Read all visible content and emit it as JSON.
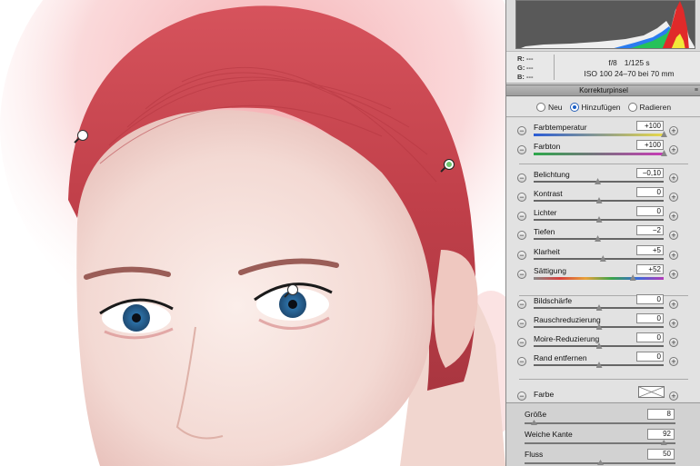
{
  "photo": {
    "pins": [
      {
        "name": "pin-left-hairline",
        "active": false
      },
      {
        "name": "pin-right-hair",
        "active": true
      },
      {
        "name": "pin-eye",
        "active": false
      }
    ]
  },
  "info": {
    "r_label": "R:",
    "r_value": "---",
    "g_label": "G:",
    "g_value": "---",
    "b_label": "B:",
    "b_value": "---",
    "aperture": "f/8",
    "shutter": "1/125 s",
    "iso": "ISO 100",
    "lens": "24–70 bei 70 mm"
  },
  "panel": {
    "title": "Korrekturpinsel",
    "modes": [
      {
        "label": "Neu",
        "selected": false
      },
      {
        "label": "Hinzufügen",
        "selected": true
      },
      {
        "label": "Radieren",
        "selected": false
      }
    ]
  },
  "sliders": [
    {
      "key": "farbtemperatur",
      "label": "Farbtemperatur",
      "value": "+100",
      "fraction": 1.0,
      "track": "temp"
    },
    {
      "key": "farbton",
      "label": "Farbton",
      "value": "+100",
      "fraction": 1.0,
      "track": "tint"
    },
    {
      "key": "belichtung",
      "label": "Belichtung",
      "value": "−0,10",
      "fraction": 0.49,
      "track": "plain"
    },
    {
      "key": "kontrast",
      "label": "Kontrast",
      "value": "0",
      "fraction": 0.5,
      "track": "plain"
    },
    {
      "key": "lichter",
      "label": "Lichter",
      "value": "0",
      "fraction": 0.5,
      "track": "plain"
    },
    {
      "key": "tiefen",
      "label": "Tiefen",
      "value": "−2",
      "fraction": 0.49,
      "track": "plain"
    },
    {
      "key": "klarheit",
      "label": "Klarheit",
      "value": "+5",
      "fraction": 0.53,
      "track": "plain"
    },
    {
      "key": "saettigung",
      "label": "Sättigung",
      "value": "+52",
      "fraction": 0.76,
      "track": "sat"
    },
    {
      "key": "bildschaerfe",
      "label": "Bildschärfe",
      "value": "0",
      "fraction": 0.5,
      "track": "plain"
    },
    {
      "key": "rauschreduzierung",
      "label": "Rauschreduzierung",
      "value": "0",
      "fraction": 0.5,
      "track": "plain"
    },
    {
      "key": "moire",
      "label": "Moire-Reduzierung",
      "value": "0",
      "fraction": 0.5,
      "track": "plain"
    },
    {
      "key": "rand",
      "label": "Rand entfernen",
      "value": "0",
      "fraction": 0.5,
      "track": "plain"
    }
  ],
  "farbe": {
    "label": "Farbe"
  },
  "brush": [
    {
      "key": "groesse",
      "label": "Größe",
      "value": "8",
      "fraction": 0.06
    },
    {
      "key": "weiche_kante",
      "label": "Weiche Kante",
      "value": "92",
      "fraction": 0.92
    },
    {
      "key": "fluss",
      "label": "Fluss",
      "value": "50",
      "fraction": 0.5
    }
  ],
  "colors": {
    "panel_bg": "#e2e2e2",
    "selected_radio": "#1a5fc8",
    "active_pin": "#6cc26c",
    "hair": "#c8444c"
  }
}
